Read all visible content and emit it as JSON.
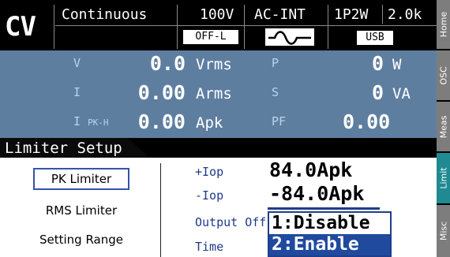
{
  "status": {
    "mode": "CV",
    "waveform_mode": "Continuous",
    "voltage_range": "100V",
    "source": "AC-INT",
    "wiring": "1P2W",
    "load": "2.0k",
    "output_state": "OFF-L",
    "waveform_icon": "sine-wave-icon",
    "interface": "USB"
  },
  "measurements": {
    "left": [
      {
        "label": "V",
        "sub": "",
        "value": "0.0",
        "unit": "Vrms"
      },
      {
        "label": "I",
        "sub": "",
        "value": "0.00",
        "unit": "Arms"
      },
      {
        "label": "I",
        "sub": "PK-H",
        "value": "0.00",
        "unit": "Apk"
      }
    ],
    "right": [
      {
        "label": "P",
        "value": "0",
        "unit": "W"
      },
      {
        "label": "S",
        "value": "0",
        "unit": "VA"
      },
      {
        "label": "PF",
        "value": "0.00",
        "unit": ""
      }
    ]
  },
  "page": {
    "title": "Limiter Setup"
  },
  "menu": {
    "items": [
      "PK Limiter",
      "RMS Limiter",
      "Setting Range"
    ],
    "selected_index": 0
  },
  "params": [
    {
      "label": "+Iop",
      "value": "84.0Apk"
    },
    {
      "label": "-Iop",
      "value": "-84.0Apk"
    },
    {
      "label": "Output Off",
      "value": ""
    },
    {
      "label": "Time",
      "value": ""
    }
  ],
  "dropdown": {
    "options": [
      "1:Disable",
      "2:Enable"
    ],
    "highlighted_index": 1
  },
  "sidetabs": [
    {
      "label": "Home",
      "active": false
    },
    {
      "label": "OSC",
      "active": false
    },
    {
      "label": "Meas",
      "active": false
    },
    {
      "label": "Limit",
      "active": true
    },
    {
      "label": "Misc",
      "active": false
    }
  ],
  "colors": {
    "meas_bg": "#5e7ea0",
    "active_tab": "#1f8a92",
    "inactive_tab": "#7d7d7d",
    "highlight": "#1f4a9e"
  }
}
